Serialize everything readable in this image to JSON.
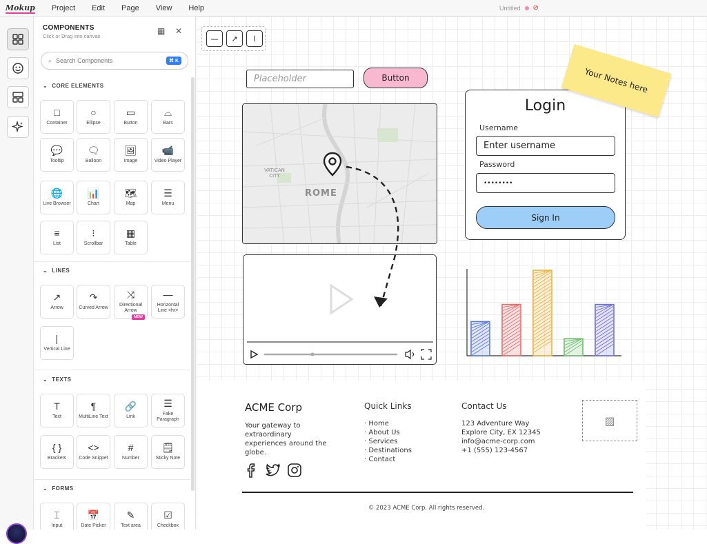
{
  "app": {
    "logo": "Mokup",
    "menu": [
      "Project",
      "Edit",
      "Page",
      "View",
      "Help"
    ],
    "document_title": "Untitled"
  },
  "rail": {
    "items": [
      "grid-icon",
      "smiley-icon",
      "layout-icon",
      "sparkle-icon"
    ]
  },
  "panel": {
    "title": "COMPONENTS",
    "subtitle": "Click or Drag into canvas",
    "search_placeholder": "Search Components",
    "search_shortcut": "⌘ K",
    "sections": [
      {
        "title": "CORE ELEMENTS",
        "items": [
          {
            "label": "Container",
            "icon": "□"
          },
          {
            "label": "Ellipse",
            "icon": "○"
          },
          {
            "label": "Button",
            "icon": "▭"
          },
          {
            "label": "Bars",
            "icon": "⌓"
          },
          {
            "label": "Tooltip",
            "icon": "💬"
          },
          {
            "label": "Balloon",
            "icon": "🗨"
          },
          {
            "label": "Image",
            "icon": "🖼"
          },
          {
            "label": "Video Player",
            "icon": "📹"
          },
          {
            "label": "Live Browser",
            "icon": "🌐"
          },
          {
            "label": "Chart",
            "icon": "📊"
          },
          {
            "label": "Map",
            "icon": "🗺"
          },
          {
            "label": "Menu",
            "icon": "☰"
          },
          {
            "label": "List",
            "icon": "≡"
          },
          {
            "label": "Scrollbar",
            "icon": "⁝"
          },
          {
            "label": "Table",
            "icon": "▦"
          }
        ]
      },
      {
        "title": "LINES",
        "items": [
          {
            "label": "Arrow",
            "icon": "↗"
          },
          {
            "label": "Curved Arrow",
            "icon": "↷"
          },
          {
            "label": "Directional Arrow",
            "icon": "⤨",
            "badge": "NEW"
          },
          {
            "label": "Horizontal Line <hr>",
            "icon": "—"
          },
          {
            "label": "Vertical Line",
            "icon": "|"
          }
        ]
      },
      {
        "title": "TEXTS",
        "items": [
          {
            "label": "Text",
            "icon": "T"
          },
          {
            "label": "MultiLine Text",
            "icon": "¶"
          },
          {
            "label": "Link",
            "icon": "🔗"
          },
          {
            "label": "Fake Paragraph",
            "icon": "☰"
          },
          {
            "label": "Brackets",
            "icon": "{ }"
          },
          {
            "label": "Code Snippet",
            "icon": "<>"
          },
          {
            "label": "Number",
            "icon": "#"
          },
          {
            "label": "Sticky Note",
            "icon": "🗒"
          }
        ]
      },
      {
        "title": "FORMS",
        "items": [
          {
            "label": "Input",
            "icon": "⌶"
          },
          {
            "label": "Date Picker",
            "icon": "📅"
          },
          {
            "label": "Text area",
            "icon": "✎"
          },
          {
            "label": "Checkbox",
            "icon": "☑"
          }
        ]
      }
    ]
  },
  "canvas": {
    "placeholder_input": "Placeholder",
    "button": "Button",
    "sticky_note": "Your Notes here",
    "map_label": "ROME",
    "map_sublabel": "VATICAN CITY",
    "login": {
      "title": "Login",
      "username_label": "Username",
      "username_value": "Enter username",
      "password_label": "Password",
      "password_value": "••••••••",
      "submit": "Sign In"
    },
    "bar_chart": {
      "colors": [
        "#5b7be0",
        "#ec6b6b",
        "#f4b13c",
        "#6fbf6f",
        "#7070dd"
      ]
    },
    "footer": {
      "company": "ACME Corp",
      "tagline": "Your gateway to extraordinary experiences around the globe.",
      "quick_links_title": "Quick Links",
      "quick_links": [
        "· Home",
        "· About Us",
        "· Services",
        "· Destinations",
        "· Contact"
      ],
      "contact_title": "Contact Us",
      "contact": [
        "123 Adventure Way",
        "Explore City, EX 12345",
        "info@acme-corp.com",
        "+1 (555) 123-4567"
      ],
      "copyright": "© 2023 ACME Corp. All rights reserved."
    }
  },
  "chart_data": {
    "type": "bar",
    "categories": [
      "",
      "",
      "",
      "",
      ""
    ],
    "values": [
      2,
      3,
      5,
      1,
      3
    ],
    "title": "",
    "xlabel": "",
    "ylabel": ""
  }
}
